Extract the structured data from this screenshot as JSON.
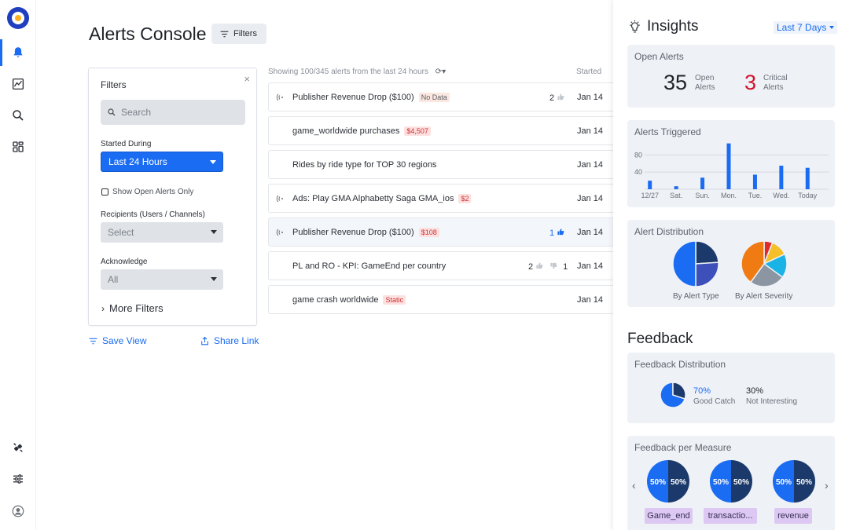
{
  "app": {
    "title": "Alerts Console",
    "filters_button": "Filters"
  },
  "icons": {
    "logo": "app-logo",
    "nav": [
      "bell-icon",
      "chart-icon",
      "search-icon",
      "dashboard-icon"
    ],
    "nav_bottom": [
      "integration-icon",
      "settings-sliders-icon",
      "user-avatar-icon"
    ]
  },
  "filter_panel": {
    "title": "Filters",
    "close": "×",
    "search_placeholder": "Search",
    "started_during_label": "Started During",
    "started_during_value": "Last 24 Hours",
    "show_open_only": "Show Open Alerts Only",
    "recipients_label": "Recipients (Users / Channels)",
    "recipients_value": "Select",
    "acknowledge_label": "Acknowledge",
    "acknowledge_value": "All",
    "more_filters": "More Filters"
  },
  "actions": {
    "save_view": "Save View",
    "share_link": "Share Link"
  },
  "list": {
    "summary": "Showing 100/345 alerts from the last 24 hours",
    "started_header": "Started",
    "rows": [
      {
        "name": "Publisher Revenue Drop ($100)",
        "tag": "No Data",
        "tag_style": "gray",
        "signal": true,
        "likes": "2",
        "dislikes": "",
        "date": "Jan 14"
      },
      {
        "name": "game_worldwide purchases",
        "tag": "$4,507",
        "tag_style": "red",
        "signal": false,
        "likes": "",
        "dislikes": "",
        "date": "Jan 14"
      },
      {
        "name": "Rides by ride type for TOP 30 regions",
        "tag": "",
        "tag_style": "",
        "signal": false,
        "likes": "",
        "dislikes": "",
        "date": "Jan 14"
      },
      {
        "name": "Ads: Play GMA Alphabetty Saga GMA_ios",
        "tag": "$2",
        "tag_style": "red",
        "signal": true,
        "likes": "",
        "dislikes": "",
        "date": "Jan 14"
      },
      {
        "name": "Publisher Revenue Drop ($100)",
        "tag": "$108",
        "tag_style": "red",
        "signal": true,
        "likes": "1",
        "dislikes": "",
        "date": "Jan 14"
      },
      {
        "name": "PL and RO - KPI: GameEnd per country",
        "tag": "",
        "tag_style": "",
        "signal": false,
        "likes": "2",
        "dislikes": "1",
        "date": "Jan 14"
      },
      {
        "name": "game crash worldwide",
        "tag": "Static",
        "tag_style": "red",
        "signal": false,
        "likes": "",
        "dislikes": "",
        "date": "Jan 14"
      }
    ]
  },
  "insights": {
    "title": "Insights",
    "range": "Last 7 Days",
    "open_alerts": {
      "title": "Open Alerts",
      "open_count": "35",
      "open_label": "Open Alerts",
      "critical_count": "3",
      "critical_label": "Critical Alerts"
    },
    "alerts_triggered": {
      "title": "Alerts Triggered"
    },
    "alert_distribution": {
      "title": "Alert Distribution",
      "by_type": "By Alert Type",
      "by_severity": "By Alert Severity"
    },
    "feedback_title": "Feedback",
    "feedback_distribution": {
      "title": "Feedback Distribution",
      "good_pct": "70%",
      "good_label": "Good Catch",
      "bad_pct": "30%",
      "bad_label": "Not Interesting"
    },
    "feedback_per_measure": {
      "title": "Feedback per Measure",
      "prev": "‹",
      "next": "›",
      "measures": [
        {
          "name": "Game_end",
          "left": "50%",
          "right": "50%"
        },
        {
          "name": "transactio...",
          "left": "50%",
          "right": "50%"
        },
        {
          "name": "revenue",
          "left": "50%",
          "right": "50%"
        }
      ]
    }
  },
  "colors": {
    "accent": "#1a6cf2",
    "critical": "#d0142c",
    "pie_dark": "#1b3a6b",
    "pie_mid": "#3d4fb8"
  },
  "chart_data": [
    {
      "type": "bar",
      "title": "Alerts Triggered",
      "categories": [
        "12/27",
        "Sat.",
        "Sun.",
        "Mon.",
        "Tue.",
        "Wed.",
        "Today"
      ],
      "values": [
        20,
        7,
        27,
        107,
        34,
        55,
        50
      ],
      "yticks": [
        40,
        80
      ],
      "ylim": [
        0,
        110
      ],
      "grid": true
    },
    {
      "type": "pie",
      "title": "By Alert Type",
      "values": [
        24,
        26,
        50
      ],
      "colors": [
        "#1b3a6b",
        "#3d4fb8",
        "#1a6cf2"
      ]
    },
    {
      "type": "pie",
      "title": "By Alert Severity",
      "values": [
        6,
        12,
        17,
        25,
        40
      ],
      "colors": [
        "#e02a2a",
        "#f5c027",
        "#19b3e6",
        "#8c96a3",
        "#f07b13"
      ]
    },
    {
      "type": "pie",
      "title": "Feedback Distribution",
      "values": [
        70,
        30
      ],
      "colors": [
        "#1a6cf2",
        "#1b3a6b"
      ]
    }
  ]
}
